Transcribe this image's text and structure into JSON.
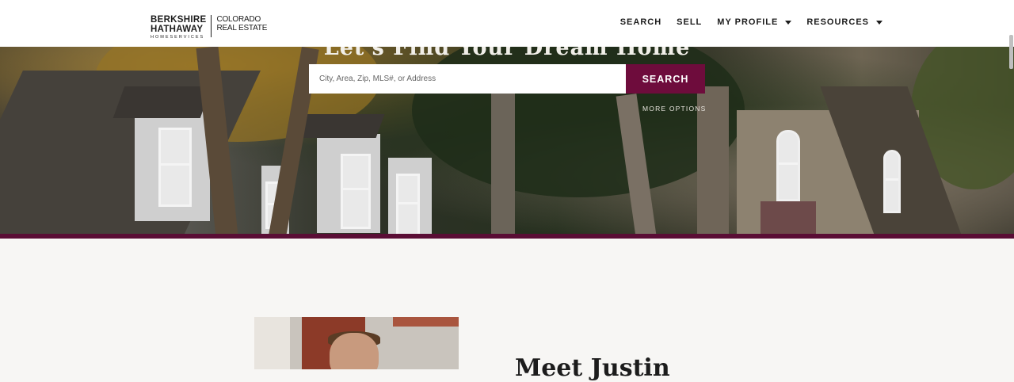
{
  "logo": {
    "line1": "BERKSHIRE",
    "line2": "HATHAWAY",
    "line3": "HOMESERVICES",
    "region_line1": "COLORADO",
    "region_line2": "REAL ESTATE"
  },
  "nav": {
    "items": [
      {
        "label": "SEARCH",
        "has_dropdown": false
      },
      {
        "label": "SELL",
        "has_dropdown": false
      },
      {
        "label": "MY PROFILE",
        "has_dropdown": true
      },
      {
        "label": "RESOURCES",
        "has_dropdown": true
      }
    ]
  },
  "hero": {
    "title": "Let's Find Your Dream Home",
    "search_placeholder": "City, Area, Zip, MLS#, or Address",
    "search_button": "SEARCH",
    "more_options": "MORE OPTIONS"
  },
  "agent": {
    "heading": "Meet Justin"
  },
  "colors": {
    "brand": "#6e0c3c",
    "accent_bar": "#5a0d35",
    "header_bg": "#ffffff",
    "page_bg": "#f7f6f4"
  }
}
